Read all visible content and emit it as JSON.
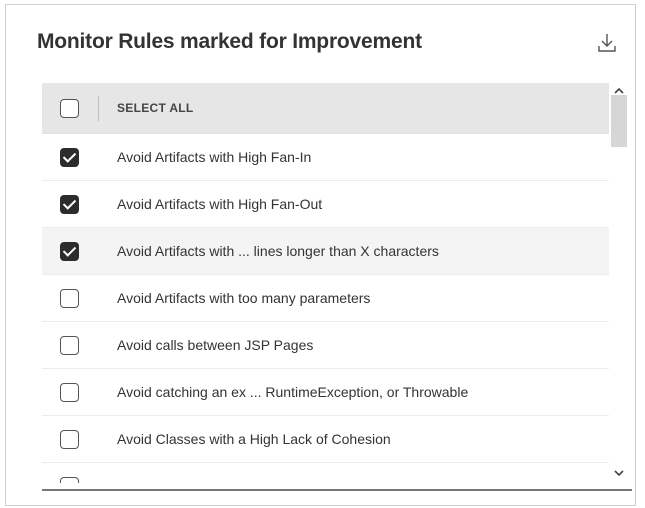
{
  "panel": {
    "title": "Monitor Rules marked for Improvement",
    "download_icon": "download-icon"
  },
  "list": {
    "select_all_label": "SELECT ALL",
    "select_all_checked": false,
    "items": [
      {
        "label": "Avoid Artifacts with High Fan-In",
        "checked": true
      },
      {
        "label": "Avoid Artifacts with High Fan-Out",
        "checked": true
      },
      {
        "label": "Avoid Artifacts with ... lines longer than X characters",
        "checked": true
      },
      {
        "label": "Avoid Artifacts with too many parameters",
        "checked": false
      },
      {
        "label": "Avoid calls between JSP Pages",
        "checked": false
      },
      {
        "label": "Avoid catching an ex ... RuntimeException, or Throwable",
        "checked": false
      },
      {
        "label": "Avoid Classes with a High Lack of Cohesion",
        "checked": false
      },
      {
        "label": "",
        "checked": false
      }
    ]
  },
  "scrollbar": {
    "up_icon": "chevron-up-icon",
    "down_icon": "chevron-down-icon"
  },
  "colors": {
    "header_bg": "#e6e6e6",
    "checked_bg": "#2c2c2c",
    "highlight_row": "#f4f4f4"
  }
}
